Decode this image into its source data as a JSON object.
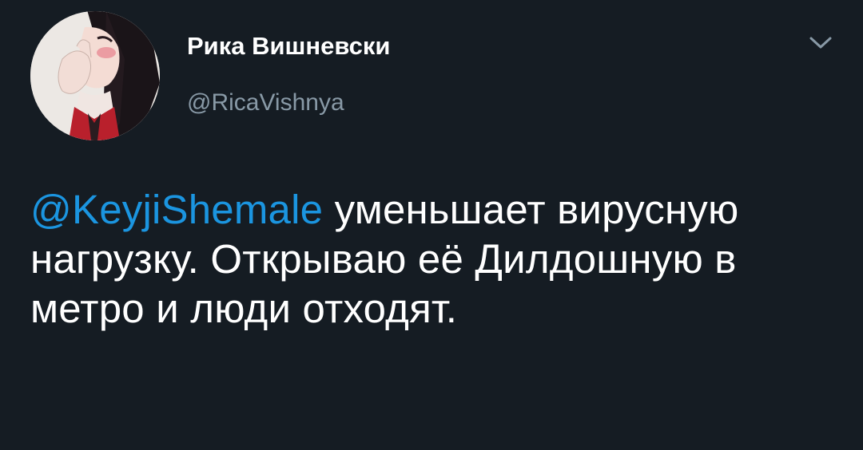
{
  "user": {
    "display_name": "Рика Вишневски",
    "handle": "@RicaVishnya",
    "avatar_icon": "avatar-image"
  },
  "menu": {
    "icon": "chevron-down-icon"
  },
  "tweet": {
    "mention": "@KeyjiShemale",
    "body": " уменьшает вирусную нагрузку. Открываю её Дилдошную в метро и люди отходят."
  },
  "colors": {
    "background": "#151c23",
    "text": "#ffffff",
    "secondary": "#8899a6",
    "link": "#1b95e0"
  }
}
